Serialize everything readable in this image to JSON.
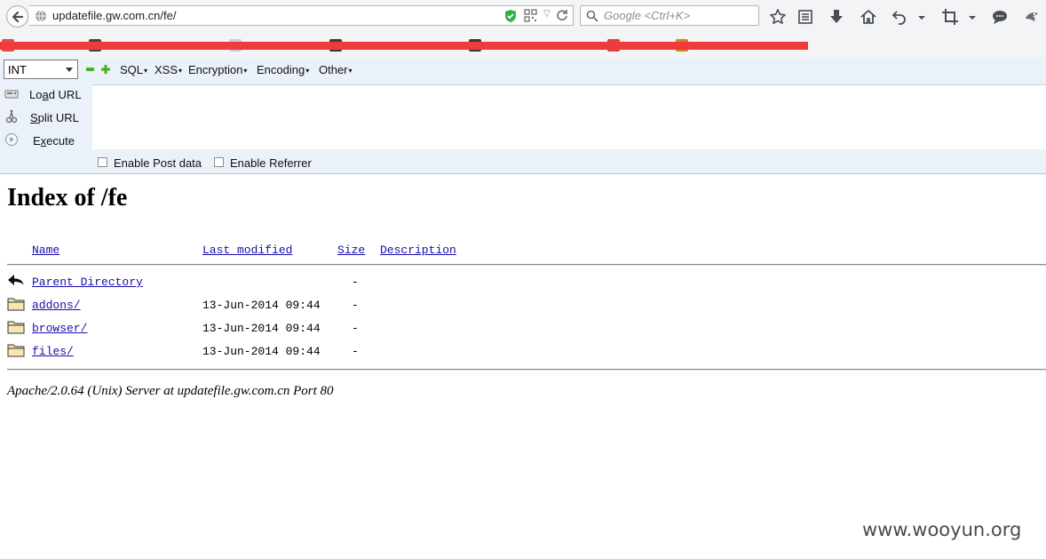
{
  "browser": {
    "url": "updatefile.gw.com.cn/fe/",
    "search_placeholder": "Google <Ctrl+K>",
    "toolbar_icons": [
      "bookmark-star-icon",
      "reading-list-icon",
      "download-icon",
      "home-icon",
      "undo-icon",
      "dropdown-icon",
      "crop-icon",
      "dropdown-icon",
      "chat-icon",
      "extension-icon"
    ]
  },
  "hackbar": {
    "select_value": "INT",
    "menus": [
      "SQL",
      "XSS",
      "Encryption",
      "Encoding",
      "Other"
    ],
    "load_url": {
      "pre": "Lo",
      "key": "a",
      "post": "d URL"
    },
    "split_url": {
      "pre": "",
      "key": "S",
      "post": "plit URL"
    },
    "execute": {
      "pre": "E",
      "key": "x",
      "post": "ecute"
    },
    "enable_post": "Enable Post data",
    "enable_referrer": "Enable Referrer"
  },
  "page": {
    "title": "Index of /fe",
    "columns": {
      "name": "Name",
      "last_modified": "Last modified",
      "size": "Size",
      "description": "Description"
    },
    "rows": [
      {
        "name": "Parent Directory",
        "modified": "",
        "size": "-",
        "icon": "back-arrow-icon"
      },
      {
        "name": "addons/",
        "modified": "13-Jun-2014 09:44",
        "size": "-",
        "icon": "folder-icon"
      },
      {
        "name": "browser/",
        "modified": "13-Jun-2014 09:44",
        "size": "-",
        "icon": "folder-icon"
      },
      {
        "name": "files/",
        "modified": "13-Jun-2014 09:44",
        "size": "-",
        "icon": "folder-icon"
      }
    ],
    "footer": "Apache/2.0.64 (Unix) Server at updatefile.gw.com.cn Port 80"
  },
  "watermark": "www.wooyun.org",
  "colors": {
    "redaction": "#ef3b3b",
    "link": "#1a0dab",
    "hackbar_bg": "#eaf1f9"
  }
}
